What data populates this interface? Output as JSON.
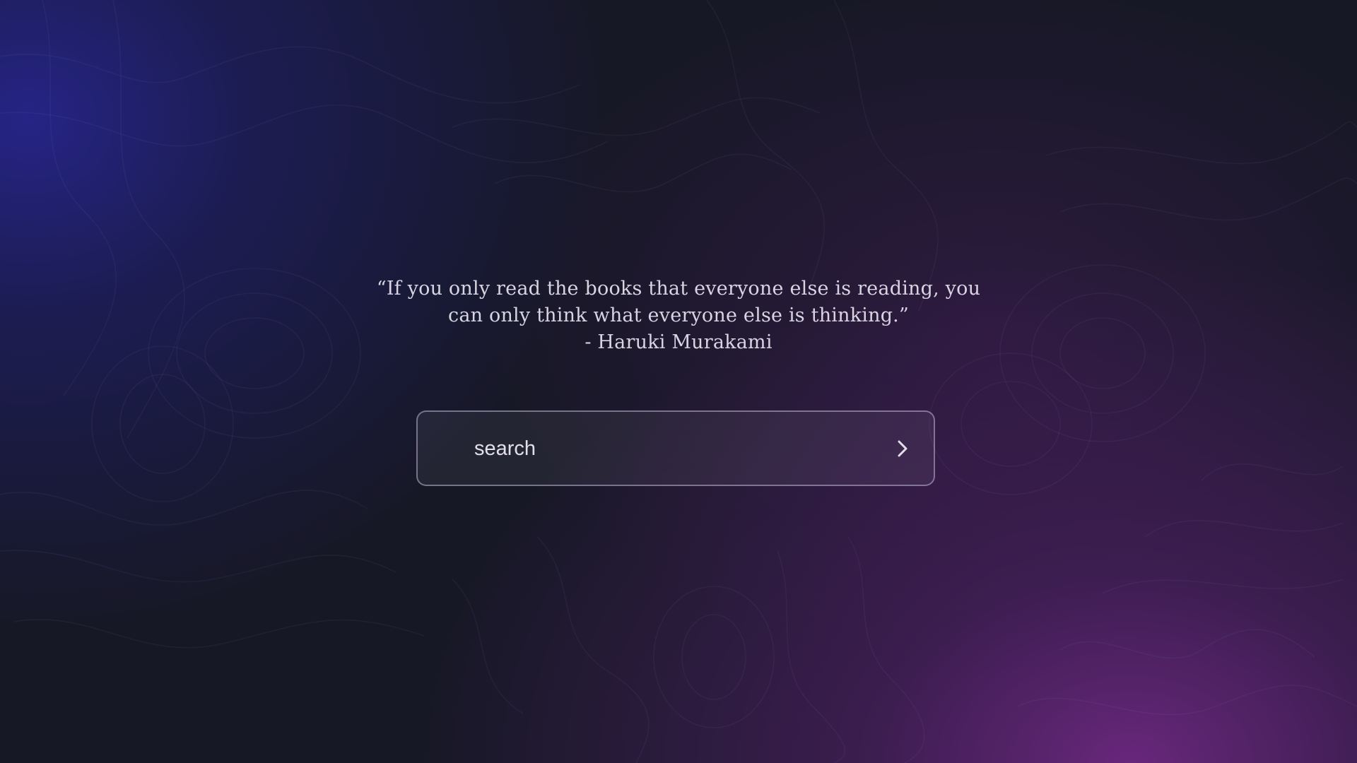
{
  "quote": {
    "line1": "“If you only read the books that everyone else is reading, you",
    "line2": "can only think what everyone else is thinking.”",
    "author": "- Haruki Murakami"
  },
  "search": {
    "placeholder": "search",
    "value": "",
    "submit_icon": "chevron-right-icon"
  },
  "colors": {
    "background_base": "#171826",
    "glow_top_left": "#28269a",
    "glow_bottom_right": "#6c2880",
    "text": "#d8d4e2"
  }
}
